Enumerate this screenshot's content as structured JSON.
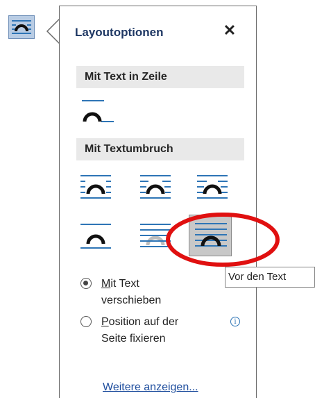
{
  "panel": {
    "title": "Layoutoptionen",
    "close_icon": "close-icon",
    "section_inline": "Mit Text in Zeile",
    "section_wrap": "Mit Textumbruch",
    "radio_move": {
      "label_underlined": "M",
      "label_rest": "it Text",
      "label_line2": "verschieben",
      "checked": true
    },
    "radio_fix": {
      "label_underlined": "P",
      "label_rest": "osition auf der",
      "label_line2": "Seite fixieren",
      "checked": false
    },
    "more_link": "Weitere anzeigen..."
  },
  "tooltip": "Vor den Text",
  "colors": {
    "accent": "#2e75b6",
    "icon_dark": "#111111",
    "selected_bg": "#c8c8c8",
    "highlight": "#e01010",
    "section_bg": "#e9e9e9",
    "anchor_button_bg": "#b8cce4"
  },
  "icons": [
    "layout-options-icon",
    "in-line-with-text-icon",
    "square-wrap-icon",
    "tight-wrap-icon",
    "through-wrap-icon",
    "top-and-bottom-wrap-icon",
    "behind-text-icon",
    "in-front-of-text-icon",
    "info-icon"
  ]
}
